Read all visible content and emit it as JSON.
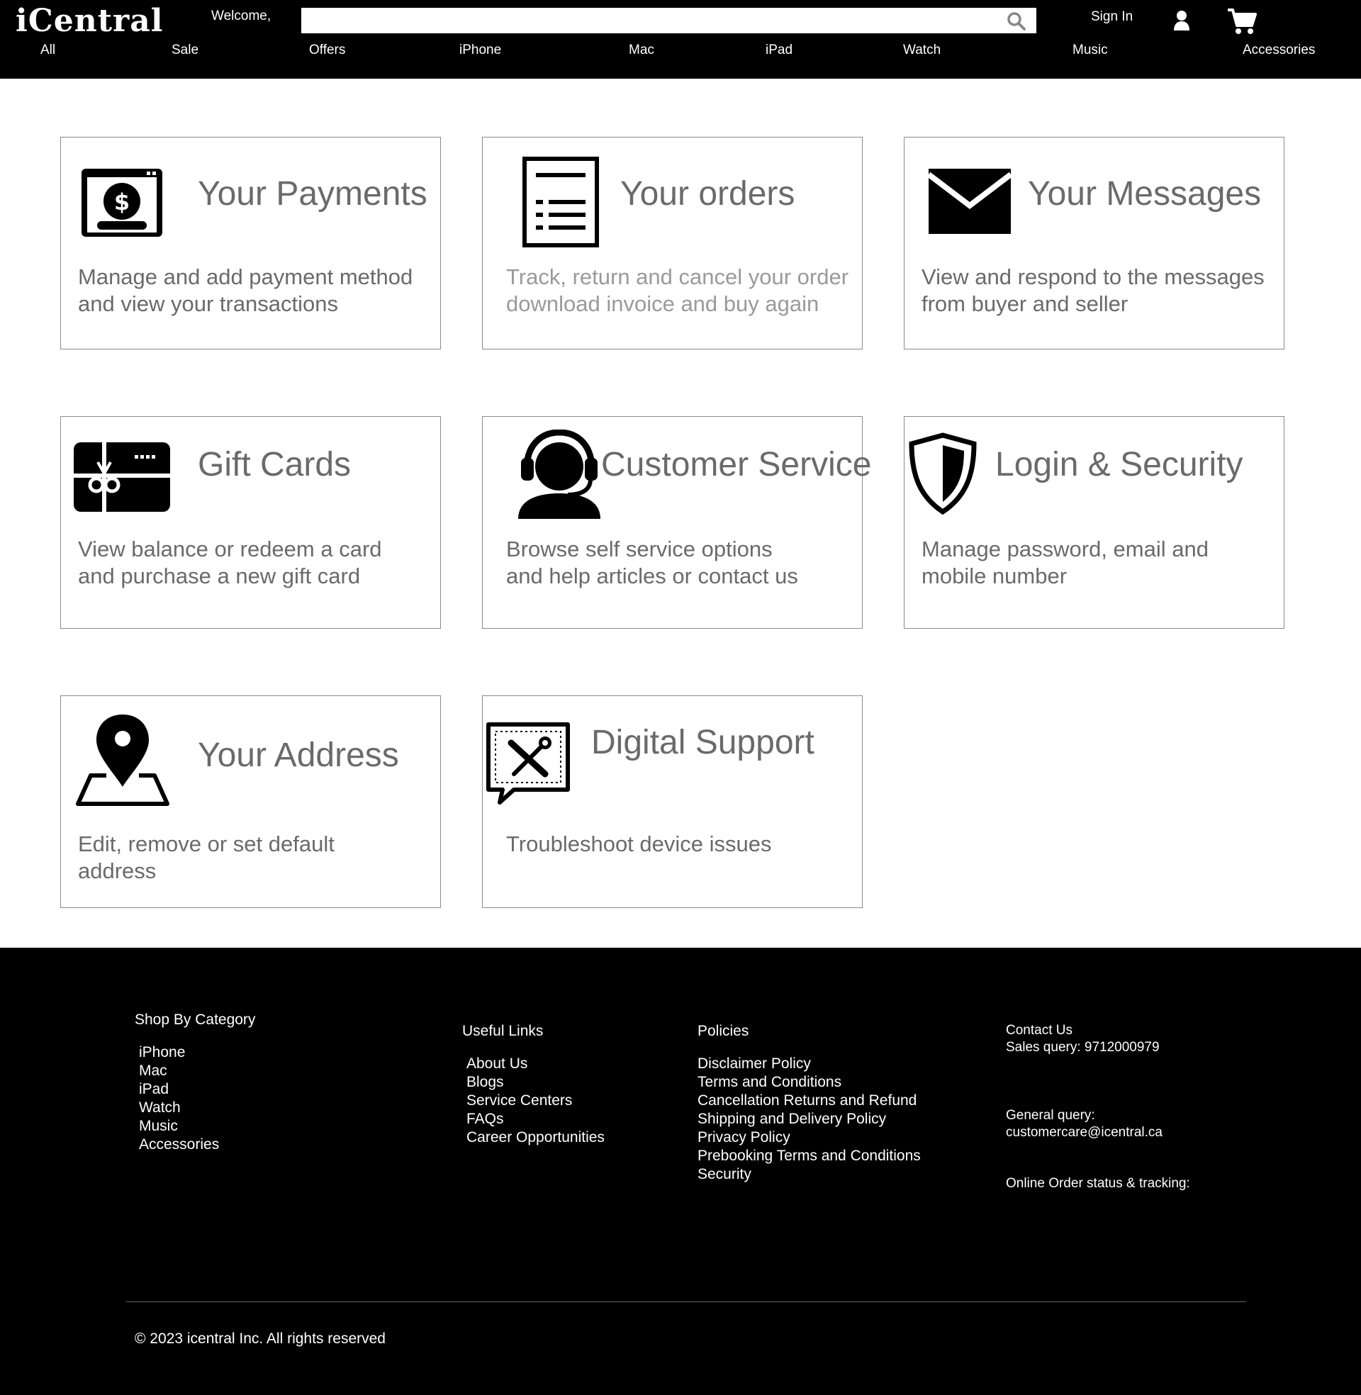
{
  "header": {
    "logo": "iCentral",
    "welcome": "Welcome,",
    "search_placeholder": "",
    "signin": "Sign In"
  },
  "nav": [
    "All",
    "Sale",
    "Offers",
    "iPhone",
    "Mac",
    "iPad",
    "Watch",
    "Music",
    "Accessories"
  ],
  "cards": [
    {
      "title": "Your Payments",
      "desc": "Manage and add payment method\nand view your transactions",
      "icon": "payment-icon"
    },
    {
      "title": "Your orders",
      "desc": "Track, return and cancel your order\ndownload invoice and buy again",
      "icon": "orders-icon"
    },
    {
      "title": "Your Messages",
      "desc": "View and respond to the messages\nfrom buyer and seller",
      "icon": "envelope-icon"
    },
    {
      "title": "Gift Cards",
      "desc": "View balance or redeem a card\nand purchase a new gift card",
      "icon": "gift-card-icon"
    },
    {
      "title": "Customer Service",
      "desc": "Browse self service options\nand help articles or contact us",
      "icon": "headset-icon"
    },
    {
      "title": "Login & Security",
      "desc": "Manage password, email and\nmobile number",
      "icon": "shield-icon"
    },
    {
      "title": "Your Address",
      "desc": "Edit, remove or set default\naddress",
      "icon": "map-pin-icon"
    },
    {
      "title": "Digital Support",
      "desc": "Troubleshoot device issues",
      "icon": "tools-icon"
    }
  ],
  "footer": {
    "shop": {
      "heading": "Shop By Category",
      "items": [
        "iPhone",
        "Mac",
        "iPad",
        "Watch",
        "Music",
        "Accessories"
      ]
    },
    "useful": {
      "heading": "Useful Links",
      "items": [
        "About Us",
        "Blogs",
        "Service Centers",
        "FAQs",
        "Career Opportunities"
      ]
    },
    "policies": {
      "heading": "Policies",
      "items": [
        "Disclaimer Policy",
        "Terms and Conditions",
        "Cancellation Returns and Refund",
        "Shipping and Delivery Policy",
        "Privacy Policy",
        "Prebooking Terms and Conditions",
        "Security"
      ]
    },
    "contact": {
      "heading": "Contact Us",
      "sales": "Sales query: 9712000979",
      "general_label": "General query:",
      "general_email": "customercare@icentral.ca",
      "tracking": "Online Order status & tracking:"
    },
    "copyright": "© 2023 icentral Inc. All rights reserved"
  }
}
